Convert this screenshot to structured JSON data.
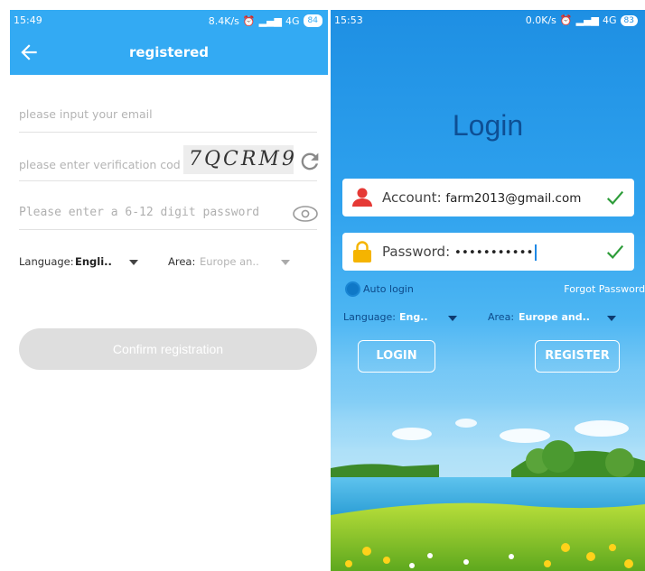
{
  "left_screen": {
    "status_bar": {
      "time": "15:49",
      "net_speed": "8.4K/s",
      "signal": "4G",
      "battery": "84"
    },
    "toolbar": {
      "title": "registered",
      "back_icon": "arrow-left-icon"
    },
    "email": {
      "placeholder": "please input your email"
    },
    "verification": {
      "placeholder": "please enter verification cod",
      "captcha_text": "7QCRM9",
      "refresh_icon": "refresh-icon"
    },
    "password": {
      "placeholder": "Please enter a 6-12 digit password",
      "toggle_icon": "eye-icon"
    },
    "language": {
      "label": "Language:",
      "value": "Engli.."
    },
    "area": {
      "label": "Area:",
      "value": "Europe an.."
    },
    "confirm_button": "Confirm registration",
    "colors": {
      "accent": "#33aaf3",
      "disabled_button": "#dedede"
    }
  },
  "right_screen": {
    "status_bar": {
      "time": "15:53",
      "net_speed": "0.0K/s",
      "signal": "4G",
      "battery": "83"
    },
    "title": "Login",
    "account": {
      "label": "Account:",
      "value": "farm2013@gmail.com",
      "icon": "user-icon",
      "valid_icon": "check-icon"
    },
    "password": {
      "label": "Password:",
      "value": "•••••••••••",
      "icon": "lock-icon",
      "valid_icon": "check-icon"
    },
    "auto_login": "Auto login",
    "forgot_password": "Forgot Password?",
    "language": {
      "label": "Language:",
      "value": "Eng.."
    },
    "area": {
      "label": "Area:",
      "value": "Europe and.."
    },
    "login_button": "LOGIN",
    "register_button": "REGISTER",
    "colors": {
      "title": "#0e4f94",
      "check": "#2e9d3a",
      "user_icon": "#e53935",
      "lock_icon": "#f5b400"
    }
  }
}
